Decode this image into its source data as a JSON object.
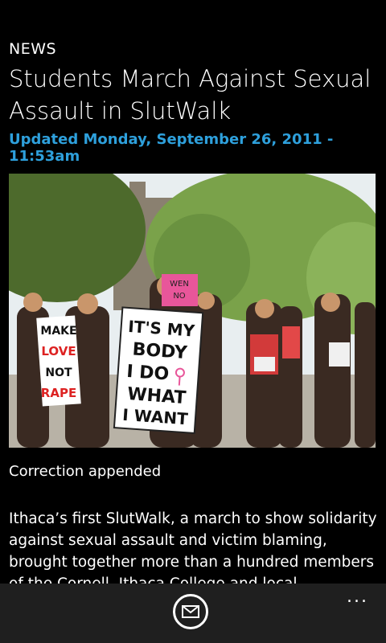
{
  "article": {
    "section": "NEWS",
    "headline": "Students March Against Sexual Assault in SlutWalk",
    "updated": "Updated Monday, September 26, 2011 - 11:53am",
    "caption": "Correction appended",
    "body": "Ithaca’s first SlutWalk, a march to show solidarity against sexual assault and victim blaming, brought together more than a hundred members of the Cornell, Ithaca College and local communities in"
  },
  "photo": {
    "signs": {
      "left": [
        "MAKE",
        "LOVE",
        "NOT",
        "RAPE"
      ],
      "center": [
        "IT'S MY",
        "BODY",
        "I DO",
        "WHAT",
        "I WANT"
      ],
      "pink": [
        "WEN",
        "NO"
      ]
    }
  },
  "appbar": {
    "mail_icon": "mail-icon",
    "more_label": "..."
  },
  "colors": {
    "accent": "#2ea0dc",
    "background": "#000000",
    "appbar": "#1f1f1f"
  }
}
